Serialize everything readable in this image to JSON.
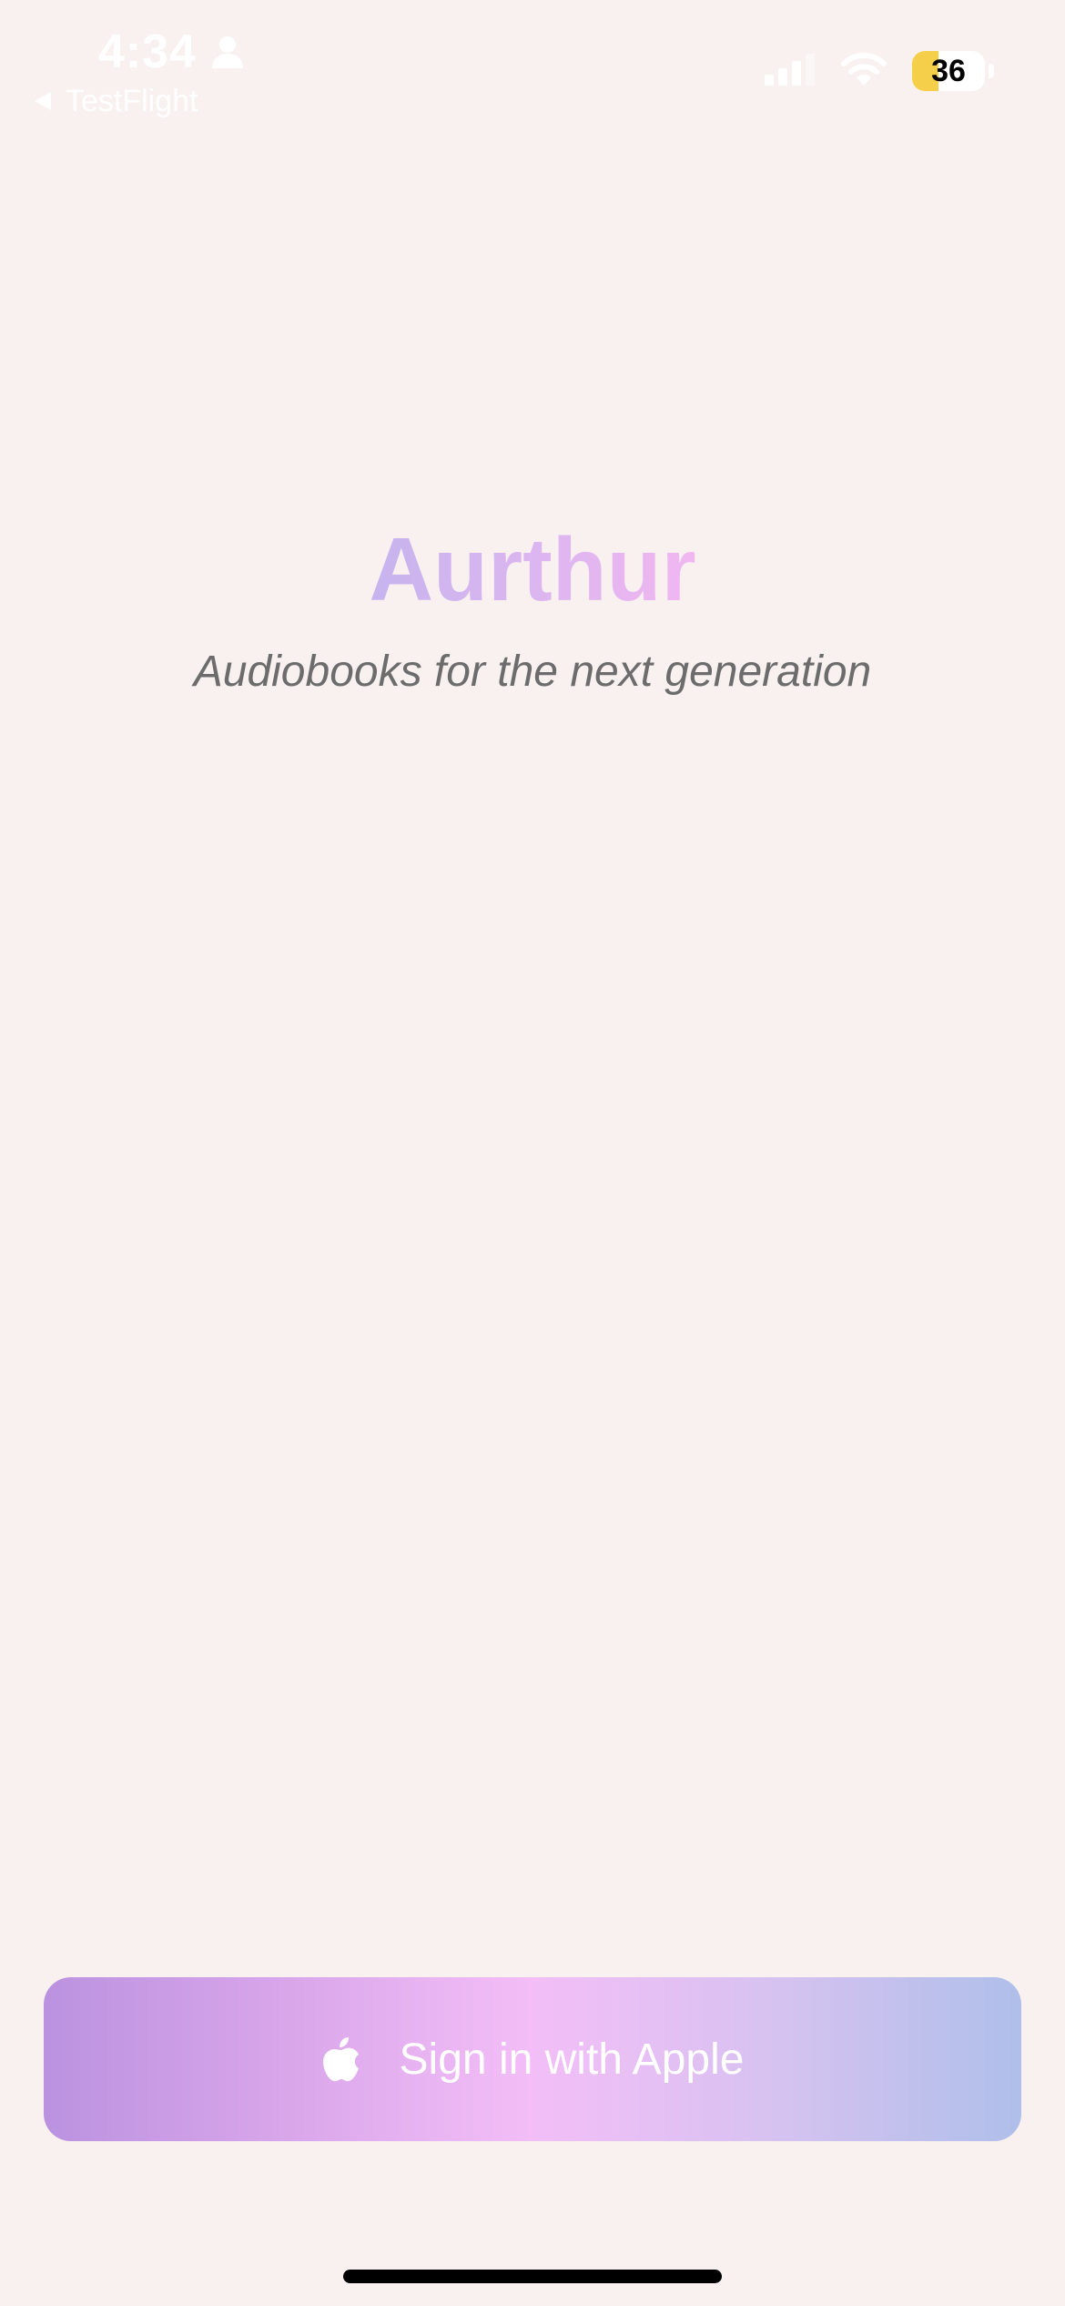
{
  "status_bar": {
    "time": "4:34",
    "back_label": "TestFlight",
    "battery_level": "36",
    "battery_fraction": 0.36
  },
  "icons": {
    "person": "person-icon",
    "back": "back-triangle-icon",
    "signal": "cellular-signal-icon",
    "wifi": "wifi-icon",
    "apple": "apple-logo-icon"
  },
  "hero": {
    "title": "Aurthur",
    "tagline": "Audiobooks for the next generation"
  },
  "signin": {
    "label": "Sign in with Apple"
  },
  "colors": {
    "background": "#F8F1F0",
    "title_gradient_start": "#C6B4EE",
    "title_gradient_end": "#F1B7F1",
    "button_gradient": [
      "#BB92E0",
      "#F3BEF7",
      "#AFBFEA"
    ],
    "battery_fill": "#F5CF4A"
  }
}
